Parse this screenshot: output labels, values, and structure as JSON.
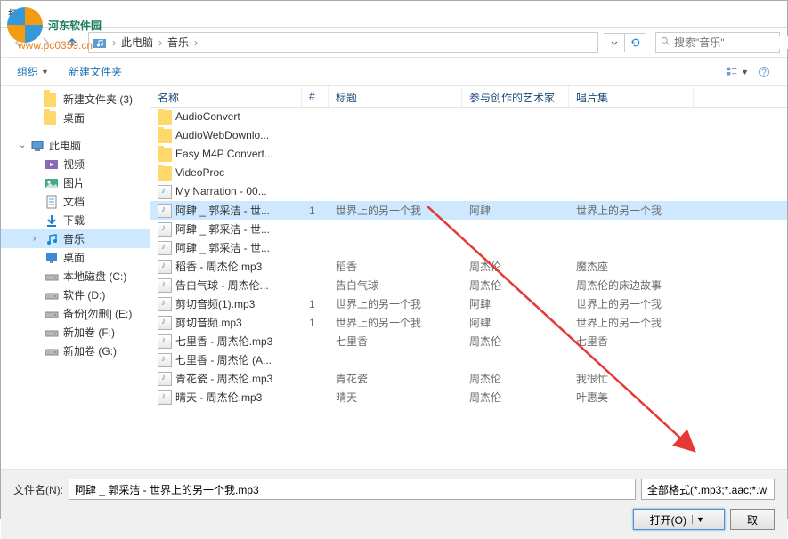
{
  "watermark": {
    "text": "河东软件园",
    "url": "www.pc0359.cn"
  },
  "dialog_title": "打开",
  "breadcrumb": {
    "seg1": "此电脑",
    "seg2": "音乐"
  },
  "search": {
    "placeholder": "搜索\"音乐\""
  },
  "toolbar": {
    "organize": "组织",
    "newfolder": "新建文件夹"
  },
  "sidebar": [
    {
      "label": "新建文件夹 (3)",
      "icon": "folder",
      "indent": 2
    },
    {
      "label": "桌面",
      "icon": "folder",
      "indent": 2
    },
    {
      "label": "",
      "icon": "",
      "indent": 0
    },
    {
      "label": "此电脑",
      "icon": "pc",
      "indent": 1,
      "chevron": "v",
      "classes": ""
    },
    {
      "label": "视频",
      "icon": "video",
      "indent": 2
    },
    {
      "label": "图片",
      "icon": "picture",
      "indent": 2
    },
    {
      "label": "文档",
      "icon": "doc",
      "indent": 2
    },
    {
      "label": "下载",
      "icon": "download",
      "indent": 2
    },
    {
      "label": "音乐",
      "icon": "music",
      "indent": 2,
      "chevron": ">",
      "classes": "selected"
    },
    {
      "label": "桌面",
      "icon": "desktop",
      "indent": 2
    },
    {
      "label": "本地磁盘 (C:)",
      "icon": "drive",
      "indent": 2
    },
    {
      "label": "软件 (D:)",
      "icon": "drive",
      "indent": 2
    },
    {
      "label": "备份[勿删] (E:)",
      "icon": "drive",
      "indent": 2
    },
    {
      "label": "新加卷 (F:)",
      "icon": "drive",
      "indent": 2
    },
    {
      "label": "新加卷 (G:)",
      "icon": "drive",
      "indent": 2
    }
  ],
  "columns": {
    "name": "名称",
    "num": "#",
    "title": "标题",
    "artist": "参与创作的艺术家",
    "album": "唱片集"
  },
  "files": [
    {
      "name": "AudioConvert",
      "type": "folder",
      "num": "",
      "title": "",
      "artist": "",
      "album": ""
    },
    {
      "name": "AudioWebDownlo...",
      "type": "folder",
      "num": "",
      "title": "",
      "artist": "",
      "album": ""
    },
    {
      "name": "Easy M4P Convert...",
      "type": "folder",
      "num": "",
      "title": "",
      "artist": "",
      "album": ""
    },
    {
      "name": "VideoProc",
      "type": "folder",
      "num": "",
      "title": "",
      "artist": "",
      "album": ""
    },
    {
      "name": "My Narration - 00...",
      "type": "audio",
      "num": "",
      "title": "",
      "artist": "",
      "album": ""
    },
    {
      "name": "阿肆 _ 郭采洁 - 世...",
      "type": "audio",
      "num": "1",
      "title": "世界上的另一个我",
      "artist": "阿肆",
      "album": "世界上的另一个我",
      "selected": true
    },
    {
      "name": "阿肆 _ 郭采洁 - 世...",
      "type": "audio",
      "num": "",
      "title": "",
      "artist": "",
      "album": ""
    },
    {
      "name": "阿肆 _ 郭采洁 - 世...",
      "type": "audio",
      "num": "",
      "title": "",
      "artist": "",
      "album": ""
    },
    {
      "name": "稻香 - 周杰伦.mp3",
      "type": "audio",
      "num": "",
      "title": "稻香",
      "artist": "周杰伦",
      "album": "魔杰座"
    },
    {
      "name": "告白气球 - 周杰伦...",
      "type": "audio",
      "num": "",
      "title": "告白气球",
      "artist": "周杰伦",
      "album": "周杰伦的床边故事"
    },
    {
      "name": "剪切音频(1).mp3",
      "type": "audio",
      "num": "1",
      "title": "世界上的另一个我",
      "artist": "阿肆",
      "album": "世界上的另一个我"
    },
    {
      "name": "剪切音频.mp3",
      "type": "audio",
      "num": "1",
      "title": "世界上的另一个我",
      "artist": "阿肆",
      "album": "世界上的另一个我"
    },
    {
      "name": "七里香 - 周杰伦.mp3",
      "type": "audio",
      "num": "",
      "title": "七里香",
      "artist": "周杰伦",
      "album": "七里香"
    },
    {
      "name": "七里香 - 周杰伦 (A...",
      "type": "audio",
      "num": "",
      "title": "",
      "artist": "",
      "album": ""
    },
    {
      "name": "青花瓷 - 周杰伦.mp3",
      "type": "audio",
      "num": "",
      "title": "青花瓷",
      "artist": "周杰伦",
      "album": "我很忙"
    },
    {
      "name": "晴天 - 周杰伦.mp3",
      "type": "audio",
      "num": "",
      "title": "晴天",
      "artist": "周杰伦",
      "album": "叶惠美"
    }
  ],
  "filename": {
    "label": "文件名(N):",
    "value": "阿肆 _ 郭采洁 - 世界上的另一个我.mp3"
  },
  "filter": "全部格式(*.mp3;*.aac;*.w",
  "buttons": {
    "open": "打开(O)",
    "cancel": "取"
  }
}
